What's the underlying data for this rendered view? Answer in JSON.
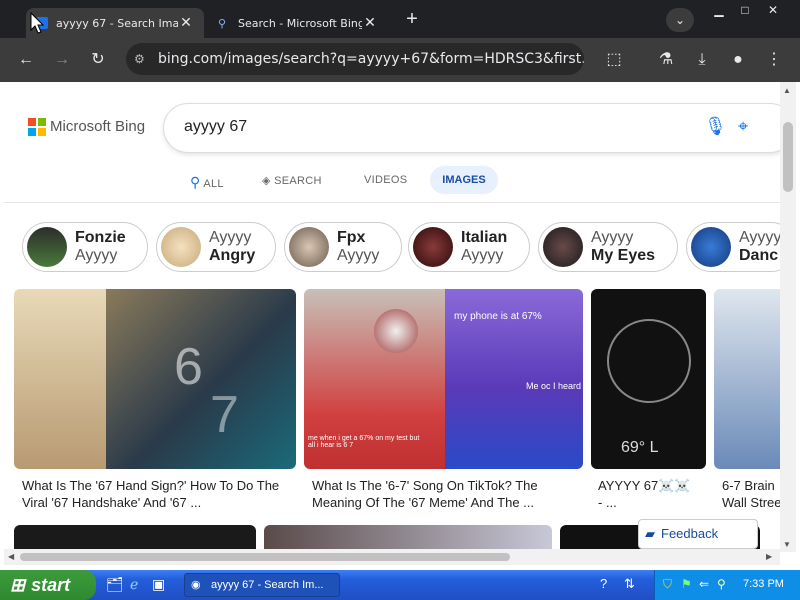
{
  "browser": {
    "tabs": [
      {
        "title": "ayyyy 67 - Search Imag"
      },
      {
        "title": "Search - Microsoft Bing"
      }
    ],
    "url": "bing.com/images/search?q=ayyyy+67&form=HDRSC3&first..."
  },
  "bing": {
    "logo_text": "Microsoft Bing",
    "query": "ayyyy 67",
    "nav": {
      "all": "ALL",
      "search": "SEARCH",
      "videos": "VIDEOS",
      "images": "IMAGES"
    }
  },
  "chips": [
    {
      "line1": "Fonzie",
      "line2": "Ayyyy"
    },
    {
      "line1": "Ayyyy",
      "line2": "Angry"
    },
    {
      "line1": "Fpx",
      "line2": "Ayyyy"
    },
    {
      "line1": "Italian",
      "line2": "Ayyyy"
    },
    {
      "line1": "Ayyyy",
      "line2": "My Eyes"
    },
    {
      "line1": "Ayyyy",
      "line2": "Danc"
    }
  ],
  "images": [
    {
      "caption1": "What Is The '67 Hand Sign?' How To Do The",
      "caption2": "Viral '67 Handshake' And '67 ..."
    },
    {
      "caption1": "What Is The '6-7' Song On TikTok? The",
      "caption2": "Meaning Of The '67 Meme' And The ..."
    },
    {
      "caption1": "AYYYY 67☠️☠️",
      "caption2": "- ..."
    },
    {
      "caption1": "6-7 Brain",
      "caption2": "Wall Stree"
    }
  ],
  "overlays": {
    "phone_text": "my phone is at 67%",
    "me_text": "Me oc I heard",
    "small_text": "me when i get a 67% on my test but all i hear is 6 7",
    "temp": "69° L"
  },
  "feedback_label": "Feedback",
  "taskbar": {
    "start_label": "start",
    "task_title": "ayyyy 67 - Search Im...",
    "clock": "7:33 PM"
  }
}
